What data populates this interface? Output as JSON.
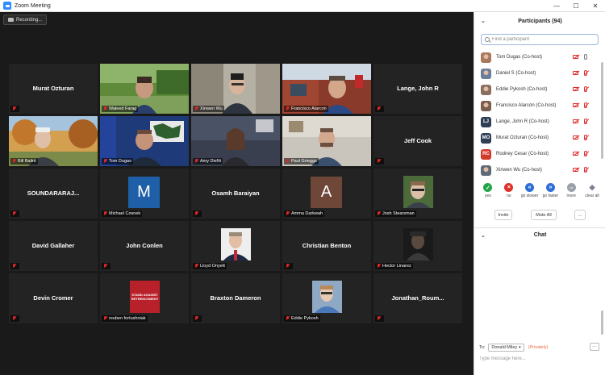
{
  "window": {
    "title": "Zoom Meeting"
  },
  "recording_label": "Recording...",
  "tiles": [
    {
      "name": "Murat Ozturan",
      "mode": "name"
    },
    {
      "name": "Waleed Farag",
      "mode": "video"
    },
    {
      "name": "Xinwen Wu",
      "mode": "video"
    },
    {
      "name": "Francisco Alarcon",
      "mode": "video"
    },
    {
      "name": "Lange, John R",
      "mode": "name"
    },
    {
      "name": "Bill Balint",
      "mode": "video",
      "active": true
    },
    {
      "name": "Tom Dugas",
      "mode": "video"
    },
    {
      "name": "Amy DieNi",
      "mode": "video"
    },
    {
      "name": "Paul Grieggs",
      "mode": "video"
    },
    {
      "name": "Jeff Cook",
      "mode": "name"
    },
    {
      "name": "SOUNDARARAJ...",
      "mode": "name"
    },
    {
      "name": "Michael Cosnek",
      "mode": "avatar",
      "letter": "M",
      "color": "#1e5fa8"
    },
    {
      "name": "Osamh Baraiyan",
      "mode": "name"
    },
    {
      "name": "Amma Darkwah",
      "mode": "avatar",
      "letter": "A",
      "color": "#6e4738"
    },
    {
      "name": "Josh Stearsman",
      "mode": "photo"
    },
    {
      "name": "David Gallaher",
      "mode": "name"
    },
    {
      "name": "John Conlen",
      "mode": "name"
    },
    {
      "name": "Lloyd Onyett",
      "mode": "photo"
    },
    {
      "name": "Christian Benton",
      "mode": "name"
    },
    {
      "name": "Hector Linarez",
      "mode": "photo"
    },
    {
      "name": "Devin Cromer",
      "mode": "name"
    },
    {
      "name": "reuben fortushniak",
      "mode": "photo"
    },
    {
      "name": "Braxton Dameron",
      "mode": "name"
    },
    {
      "name": "Eddie Pykosh",
      "mode": "photo"
    },
    {
      "name": "Jonathan_Roum...",
      "mode": "name"
    }
  ],
  "poster_text": [
    "STAND AGAINST",
    "RETRENCHMENT"
  ],
  "panel": {
    "title": "Participants (94)",
    "search_placeholder": "Find a participant",
    "participants": [
      {
        "name": "Tom Dugas (Co-host)",
        "av": "photo",
        "color": "#a87a5b",
        "mic_on": true
      },
      {
        "name": "Daniel S (Co-host)",
        "av": "photo",
        "color": "#6b7f9b",
        "mic_on": false
      },
      {
        "name": "Eddie Pykosh (Co-host)",
        "av": "photo",
        "color": "#8a6f5e",
        "mic_on": false
      },
      {
        "name": "Francisco Alarcón (Co-host)",
        "av": "photo",
        "color": "#7a5d4e",
        "mic_on": false
      },
      {
        "name": "Lange, John R (Co-host)",
        "av": "LJ",
        "color": "#2f3e55",
        "mic_on": false
      },
      {
        "name": "Murat Ozturan (Co-host)",
        "av": "MO",
        "color": "#2f3e55",
        "mic_on": false
      },
      {
        "name": "Rodney Cesar (Co-host)",
        "av": "RC",
        "color": "#d23a2a",
        "mic_on": false
      },
      {
        "name": "Xinwen Wu (Co-host)",
        "av": "photo",
        "color": "#5e6b78",
        "mic_on": false
      }
    ],
    "reactions": [
      {
        "label": "yes",
        "glyph": "✓",
        "color": "#22a548"
      },
      {
        "label": "no",
        "glyph": "×",
        "color": "#e0302a"
      },
      {
        "label": "go slower",
        "glyph": "«",
        "color": "#2d6fd6"
      },
      {
        "label": "go faster",
        "glyph": "»",
        "color": "#2d6fd6"
      },
      {
        "label": "more",
        "glyph": "•••",
        "color": "#9aa0a8"
      },
      {
        "label": "clear all",
        "glyph": "◆",
        "color": "#7a8090"
      }
    ],
    "buttons": {
      "invite": "Invite",
      "mute_all": "Mute All",
      "more": "..."
    },
    "chat": {
      "title": "Chat",
      "to_label": "To:",
      "to_value": "Donald Miley",
      "privately": "(Privately)",
      "more": "···",
      "placeholder": "Type message here..."
    }
  }
}
